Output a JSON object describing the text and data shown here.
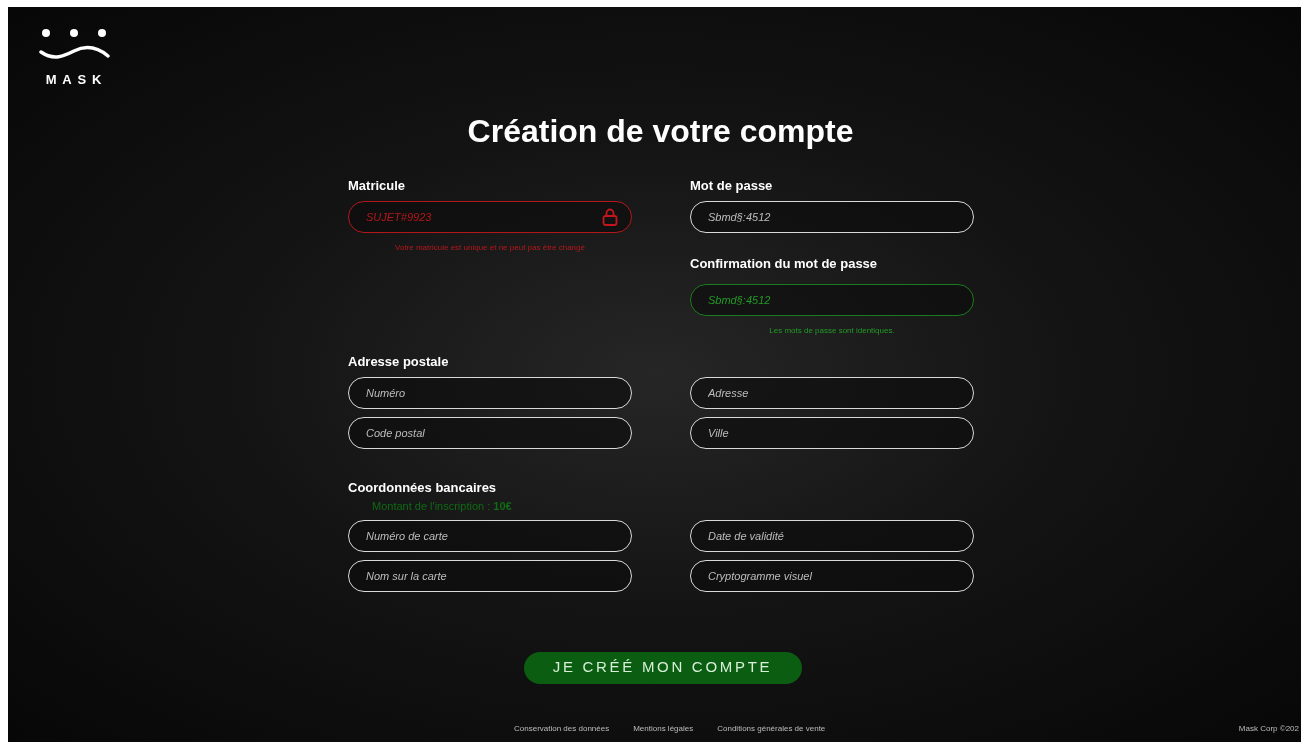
{
  "logo": {
    "text": "MASK"
  },
  "title": "Création de votre compte",
  "account": {
    "matricule": {
      "label": "Matricule",
      "value": "SUJET#9923",
      "kind": "error",
      "locked": true,
      "hint": "Votre matricule est unique et ne peut pas être changé"
    },
    "password": {
      "label": "Mot de passe",
      "value": "Sbmd§:4512"
    },
    "confirmation": {
      "label": "Confirmation du mot de passe",
      "value": "Sbmd§:4512",
      "kind": "valid",
      "hint": "Les mots de passe sont identiques."
    }
  },
  "address": {
    "label": "Adresse postale",
    "fields": [
      {
        "placeholder": "Numéro"
      },
      {
        "placeholder": "Adresse"
      },
      {
        "placeholder": "Code postal"
      },
      {
        "placeholder": "Ville"
      }
    ]
  },
  "bank": {
    "label": "Coordonnées bancaires",
    "fee": "Montant de l'inscription : **10€**",
    "fields": [
      {
        "placeholder": "Numéro de carte"
      },
      {
        "placeholder": "Date de validité"
      },
      {
        "placeholder": "Nom sur la carte"
      },
      {
        "placeholder": "Cryptogramme visuel"
      }
    ]
  },
  "submit": "JE CRÉÉ MON COMPTE",
  "footer": {
    "links": [
      "Conservation des données",
      "Mentions légales",
      "Conditions générales de vente"
    ],
    "copyright": "Mask Corp ©202"
  }
}
